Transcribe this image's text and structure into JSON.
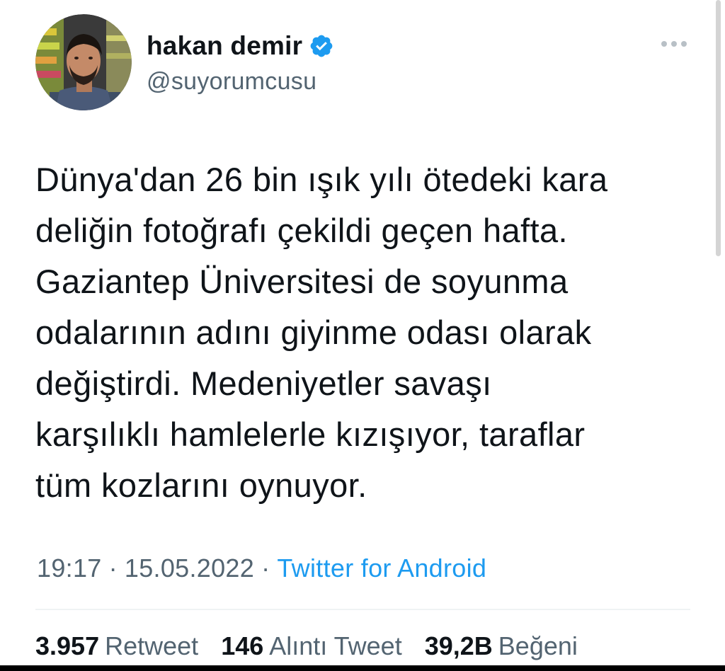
{
  "author": {
    "display_name": "hakan demir",
    "handle": "@suyorumcusu",
    "verified": true,
    "verified_icon": "verified-badge-icon",
    "avatar_icon": "profile-photo"
  },
  "menu_icon": "more-options-icon",
  "tweet": {
    "lines": [
      "Dünya'dan 26 bin ışık yılı ötedeki kara",
      "deliğin fotoğrafı çekildi geçen hafta.",
      "Gaziantep Üniversitesi de soyunma",
      "odalarının adını giyinme odası olarak",
      "değiştirdi. Medeniyetler savaşı",
      "karşılıklı hamlelerle kızışıyor, taraflar",
      "tüm kozlarını oynuyor."
    ]
  },
  "meta": {
    "time": "19:17",
    "separator": "·",
    "date": "15.05.2022",
    "source": "Twitter for Android"
  },
  "stats": {
    "retweets_count": "3.957",
    "retweets_label": "Retweet",
    "quotes_count": "146",
    "quotes_label": "Alıntı Tweet",
    "likes_count": "39,2B",
    "likes_label": "Beğeni"
  },
  "colors": {
    "text": "#0f1419",
    "secondary": "#536471",
    "accent": "#1d9bf0",
    "divider": "#eff3f4"
  }
}
